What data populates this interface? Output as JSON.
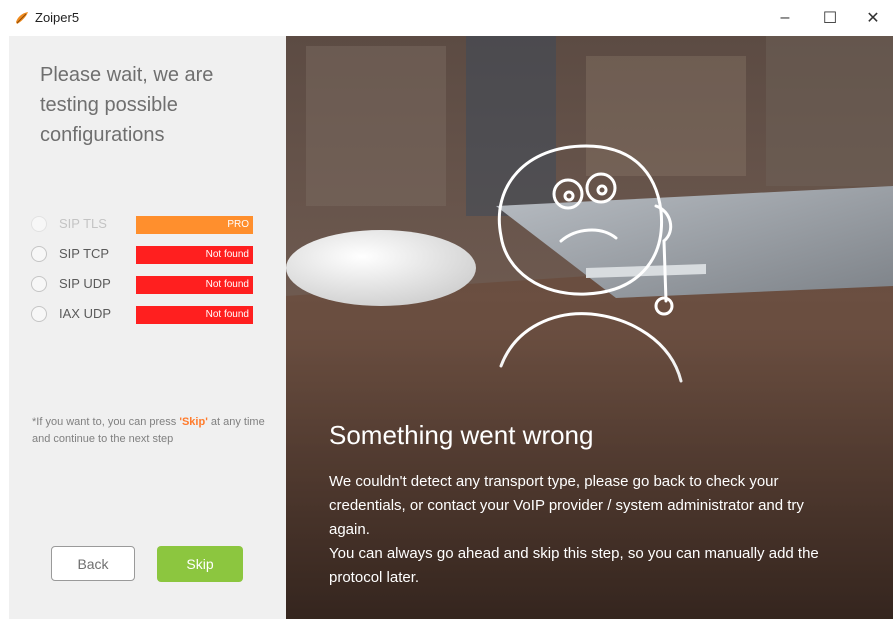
{
  "window": {
    "title": "Zoiper5",
    "minimize": "–",
    "maximize": "☐",
    "close": "✕"
  },
  "left": {
    "heading": "Please wait, we are testing possible configurations",
    "options": [
      {
        "label": "SIP TLS",
        "status": "PRO"
      },
      {
        "label": "SIP TCP",
        "status": "Not found"
      },
      {
        "label": "SIP UDP",
        "status": "Not found"
      },
      {
        "label": "IAX UDP",
        "status": "Not found"
      }
    ],
    "hint_prefix": "*If you want to, you can press ",
    "hint_skip": "'Skip'",
    "hint_suffix": " at any time and continue to the next step",
    "back_label": "Back",
    "skip_label": "Skip"
  },
  "right": {
    "title": "Something went wrong",
    "body_line1": "We couldn't detect any transport type, please go back to check your credentials, or contact your VoIP provider / system administrator and try again.",
    "body_line2": "You can always go ahead and skip this step, so you can manually add the protocol later."
  },
  "colors": {
    "pro": "#ff8f2d",
    "not_found": "#ff1f1f",
    "skip_button": "#8cc63f",
    "skip_word": "#ff7b2c"
  }
}
